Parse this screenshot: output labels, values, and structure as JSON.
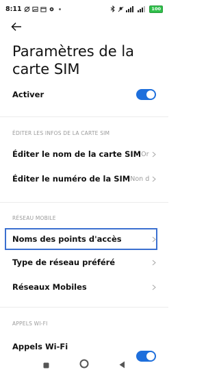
{
  "status_bar": {
    "time": "8:11",
    "battery": "100"
  },
  "header": {
    "title": "Paramètres de la carte SIM"
  },
  "activate": {
    "label": "Activer",
    "enabled": true
  },
  "sections": {
    "edit_sim": {
      "header": "ÉDITER LES INFOS DE LA CARTE SIM",
      "items": [
        {
          "label": "Éditer le nom de la carte SIM",
          "value": "Orange F"
        },
        {
          "label": "Éditer le numéro de la SIM",
          "value": "Non défini"
        }
      ]
    },
    "mobile_network": {
      "header": "RÉSEAU MOBILE",
      "items": [
        {
          "label": "Noms des points d'accès"
        },
        {
          "label": "Type de réseau préféré"
        },
        {
          "label": "Réseaux Mobiles"
        }
      ]
    },
    "wifi_calls": {
      "header": "APPELS WI-FI",
      "items": [
        {
          "label": "Appels Wi-Fi",
          "enabled": true
        }
      ]
    }
  },
  "colors": {
    "accent": "#1e6fdc",
    "focus": "#3a6fd0",
    "secondary_text": "#9a9a9a"
  }
}
